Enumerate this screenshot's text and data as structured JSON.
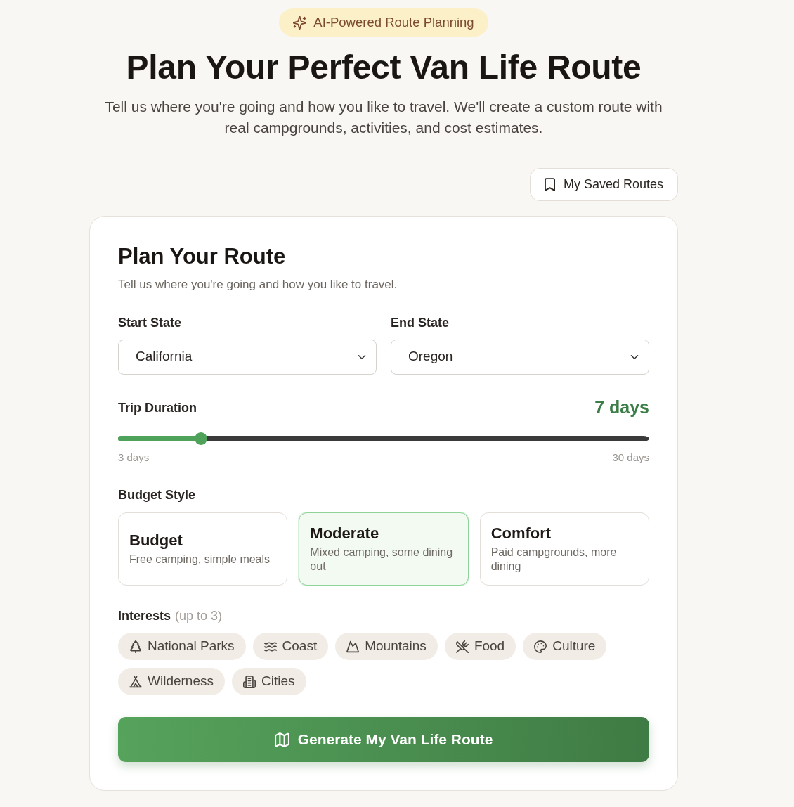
{
  "badge": {
    "text": "AI-Powered Route Planning"
  },
  "hero": {
    "title": "Plan Your Perfect Van Life Route",
    "subtitle": "Tell us where you're going and how you like to travel. We'll create a custom route with real campgrounds, activities, and cost estimates."
  },
  "saved_routes_button": {
    "label": "My Saved Routes"
  },
  "form": {
    "title": "Plan Your Route",
    "subtitle": "Tell us where you're going and how you like to travel.",
    "start_state": {
      "label": "Start State",
      "value": "California"
    },
    "end_state": {
      "label": "End State",
      "value": "Oregon"
    },
    "trip_duration": {
      "label": "Trip Duration",
      "reading": "7 days",
      "level": 0.148,
      "min_label": "3 days",
      "max_label": "30 days"
    },
    "budget_style": {
      "label": "Budget Style",
      "options": [
        {
          "title": "Budget",
          "description": "Free camping, simple meals",
          "selected": false
        },
        {
          "title": "Moderate",
          "description": "Mixed camping, some dining out",
          "selected": true
        },
        {
          "title": "Comfort",
          "description": "Paid campgrounds, more dining",
          "selected": false
        }
      ]
    },
    "interests": {
      "label": "Interests",
      "hint": "(up to 3)",
      "options": [
        {
          "label": "National Parks",
          "selected": false
        },
        {
          "label": "Coast",
          "selected": false
        },
        {
          "label": "Mountains",
          "selected": false
        },
        {
          "label": "Food",
          "selected": false
        },
        {
          "label": "Culture",
          "selected": false
        },
        {
          "label": "Wilderness",
          "selected": false
        },
        {
          "label": "Cities",
          "selected": false
        }
      ]
    },
    "generate_button": {
      "label": "Generate My Van Life Route"
    }
  }
}
